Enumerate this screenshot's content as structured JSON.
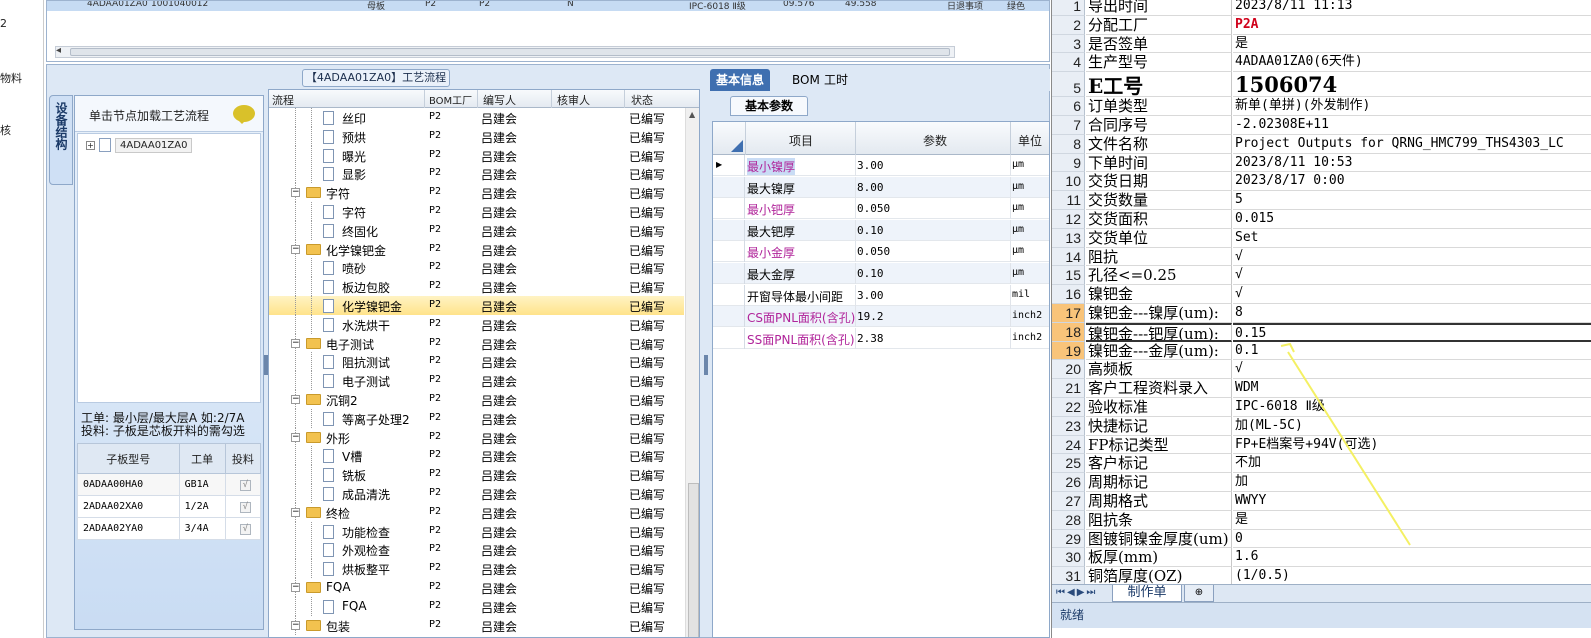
{
  "left_strip": {
    "items": [
      "2",
      "物料",
      "核"
    ]
  },
  "top_grid": {
    "row": [
      "4ADAA01ZA0",
      "1001040012",
      "母板",
      "P2",
      "P2",
      "N",
      "IPC-6018 Ⅱ级",
      "09.576",
      "49.558",
      "日退事项",
      "绿色"
    ]
  },
  "left_panel": {
    "vtab": "设备结构",
    "hint": "单击节点加载工艺流程",
    "tree_node": "4ADAA01ZA0",
    "info_line1": "工单: 最小层/最大层A 如:2/7A",
    "info_line2": "投料: 子板是芯板开料的需勾选",
    "table": {
      "headers": [
        "子板型号",
        "工单",
        "投料"
      ],
      "rows": [
        {
          "model": "0ADAA00HA0",
          "order": "GB1A",
          "check": "√"
        },
        {
          "model": "2ADAA02XA0",
          "order": "1/2A",
          "check": "√"
        },
        {
          "model": "2ADAA02YA0",
          "order": "3/4A",
          "check": "√"
        }
      ]
    }
  },
  "flow": {
    "title": "【4ADAA01ZA0】工艺流程",
    "headers": [
      "流程",
      "BOM工厂",
      "编写人",
      "核审人",
      "状态"
    ],
    "rows": [
      {
        "name": "丝印",
        "level": 2,
        "type": "doc",
        "bom": "P2",
        "editor": "吕建会",
        "status": "已编写"
      },
      {
        "name": "预烘",
        "level": 2,
        "type": "doc",
        "bom": "P2",
        "editor": "吕建会",
        "status": "已编写"
      },
      {
        "name": "曝光",
        "level": 2,
        "type": "doc",
        "bom": "P2",
        "editor": "吕建会",
        "status": "已编写"
      },
      {
        "name": "显影",
        "level": 2,
        "type": "doc",
        "bom": "P2",
        "editor": "吕建会",
        "status": "已编写"
      },
      {
        "name": "字符",
        "level": 1,
        "type": "folder",
        "bom": "P2",
        "editor": "吕建会",
        "status": "已编写"
      },
      {
        "name": "字符",
        "level": 2,
        "type": "doc",
        "bom": "P2",
        "editor": "吕建会",
        "status": "已编写"
      },
      {
        "name": "终固化",
        "level": 2,
        "type": "doc",
        "bom": "P2",
        "editor": "吕建会",
        "status": "已编写"
      },
      {
        "name": "化学镍钯金",
        "level": 1,
        "type": "folder",
        "bom": "P2",
        "editor": "吕建会",
        "status": "已编写"
      },
      {
        "name": "喷砂",
        "level": 2,
        "type": "doc",
        "bom": "P2",
        "editor": "吕建会",
        "status": "已编写"
      },
      {
        "name": "板边包胶",
        "level": 2,
        "type": "doc",
        "bom": "P2",
        "editor": "吕建会",
        "status": "已编写"
      },
      {
        "name": "化学镍钯金",
        "level": 2,
        "type": "doc",
        "bom": "P2",
        "editor": "吕建会",
        "status": "已编写",
        "selected": true
      },
      {
        "name": "水洗烘干",
        "level": 2,
        "type": "doc",
        "bom": "P2",
        "editor": "吕建会",
        "status": "已编写"
      },
      {
        "name": "电子测试",
        "level": 1,
        "type": "folder",
        "bom": "P2",
        "editor": "吕建会",
        "status": "已编写"
      },
      {
        "name": "阻抗测试",
        "level": 2,
        "type": "doc",
        "bom": "P2",
        "editor": "吕建会",
        "status": "已编写"
      },
      {
        "name": "电子测试",
        "level": 2,
        "type": "doc",
        "bom": "P2",
        "editor": "吕建会",
        "status": "已编写"
      },
      {
        "name": "沉铜2",
        "level": 1,
        "type": "folder",
        "bom": "P2",
        "editor": "吕建会",
        "status": "已编写"
      },
      {
        "name": "等离子处理2",
        "level": 2,
        "type": "doc",
        "bom": "P2",
        "editor": "吕建会",
        "status": "已编写"
      },
      {
        "name": "外形",
        "level": 1,
        "type": "folder",
        "bom": "P2",
        "editor": "吕建会",
        "status": "已编写"
      },
      {
        "name": "V槽",
        "level": 2,
        "type": "doc",
        "bom": "P2",
        "editor": "吕建会",
        "status": "已编写"
      },
      {
        "name": "铣板",
        "level": 2,
        "type": "doc",
        "bom": "P2",
        "editor": "吕建会",
        "status": "已编写"
      },
      {
        "name": "成品清洗",
        "level": 2,
        "type": "doc",
        "bom": "P2",
        "editor": "吕建会",
        "status": "已编写"
      },
      {
        "name": "终检",
        "level": 1,
        "type": "folder",
        "bom": "P2",
        "editor": "吕建会",
        "status": "已编写"
      },
      {
        "name": "功能检查",
        "level": 2,
        "type": "doc",
        "bom": "P2",
        "editor": "吕建会",
        "status": "已编写"
      },
      {
        "name": "外观检查",
        "level": 2,
        "type": "doc",
        "bom": "P2",
        "editor": "吕建会",
        "status": "已编写"
      },
      {
        "name": "烘板整平",
        "level": 2,
        "type": "doc",
        "bom": "P2",
        "editor": "吕建会",
        "status": "已编写"
      },
      {
        "name": "FQA",
        "level": 1,
        "type": "folder",
        "bom": "P2",
        "editor": "吕建会",
        "status": "已编写"
      },
      {
        "name": "FQA",
        "level": 2,
        "type": "doc",
        "bom": "P2",
        "editor": "吕建会",
        "status": "已编写"
      },
      {
        "name": "包装",
        "level": 1,
        "type": "folder",
        "bom": "P2",
        "editor": "吕建会",
        "status": "已编写"
      }
    ]
  },
  "params": {
    "tabs": [
      "基本信息",
      "BOM",
      "工时"
    ],
    "subtab": "基本参数",
    "headers": [
      "项目",
      "参数",
      "单位"
    ],
    "rows": [
      {
        "item": "最小镍厚",
        "value": "3.00",
        "unit": "μm",
        "pink": true,
        "current": true
      },
      {
        "item": "最大镍厚",
        "value": "8.00",
        "unit": "μm",
        "pink": false
      },
      {
        "item": "最小钯厚",
        "value": "0.050",
        "unit": "μm",
        "pink": true
      },
      {
        "item": "最大钯厚",
        "value": "0.10",
        "unit": "μm",
        "pink": false
      },
      {
        "item": "最小金厚",
        "value": "0.050",
        "unit": "μm",
        "pink": true
      },
      {
        "item": "最大金厚",
        "value": "0.10",
        "unit": "μm",
        "pink": false
      },
      {
        "item": "开窗导体最小间距",
        "value": "3.00",
        "unit": "mil",
        "pink": false
      },
      {
        "item": "CS面PNL面积(含孔)",
        "value": "19.2",
        "unit": "inch2",
        "pink": true
      },
      {
        "item": "SS面PNL面积(含孔)",
        "value": "2.38",
        "unit": "inch2",
        "pink": true
      }
    ]
  },
  "sheet": {
    "rows": [
      {
        "n": "1",
        "a": "导出时间",
        "b": "2023/8/11 11:13"
      },
      {
        "n": "2",
        "a": "分配工厂",
        "b": "P2A",
        "red": true
      },
      {
        "n": "3",
        "a": "是否签单",
        "b": "是"
      },
      {
        "n": "4",
        "a": "生产型号",
        "b": "4ADAA01ZA0(6天件)"
      },
      {
        "n": "5",
        "a": "E工号",
        "b": "1506074",
        "big": true
      },
      {
        "n": "6",
        "a": "订单类型",
        "b": "新单(单拼)(外发制作)"
      },
      {
        "n": "7",
        "a": "合同序号",
        "b": "-2.02308E+11"
      },
      {
        "n": "8",
        "a": "文件名称",
        "b": "Project Outputs for QRNG_HMC799_THS4303_LC"
      },
      {
        "n": "9",
        "a": "下单时间",
        "b": "2023/8/11 10:53"
      },
      {
        "n": "10",
        "a": "交货日期",
        "b": "2023/8/17 0:00"
      },
      {
        "n": "11",
        "a": "交货数量",
        "b": "5"
      },
      {
        "n": "12",
        "a": "交货面积",
        "b": "0.015"
      },
      {
        "n": "13",
        "a": "交货单位",
        "b": "Set"
      },
      {
        "n": "14",
        "a": "阻抗",
        "b": "√"
      },
      {
        "n": "15",
        "a": "孔径<=0.25",
        "b": "√"
      },
      {
        "n": "16",
        "a": "镍钯金",
        "b": "√"
      },
      {
        "n": "17",
        "a": "镍钯金---镍厚(um):",
        "b": "8",
        "hl": true
      },
      {
        "n": "18",
        "a": "镍钯金---钯厚(um):",
        "b": "0.15",
        "hl": true,
        "sel": true
      },
      {
        "n": "19",
        "a": "镍钯金---金厚(um):",
        "b": "0.1",
        "hl": true
      },
      {
        "n": "20",
        "a": "高频板",
        "b": "√"
      },
      {
        "n": "21",
        "a": "客户工程资料录入",
        "b": "WDM"
      },
      {
        "n": "22",
        "a": "验收标准",
        "b": "IPC-6018 Ⅱ级"
      },
      {
        "n": "23",
        "a": "快捷标记",
        "b": "加(ML-5C)"
      },
      {
        "n": "24",
        "a": "FP标记类型",
        "b": "FP+E档案号+94V(可选)"
      },
      {
        "n": "25",
        "a": "客户标记",
        "b": "不加"
      },
      {
        "n": "26",
        "a": "周期标记",
        "b": "加"
      },
      {
        "n": "27",
        "a": "周期格式",
        "b": "WWYY"
      },
      {
        "n": "28",
        "a": "阻抗条",
        "b": "是"
      },
      {
        "n": "29",
        "a": "图镀铜镍金厚度(um)",
        "b": "0"
      },
      {
        "n": "30",
        "a": "板厚(mm)",
        "b": "1.6"
      },
      {
        "n": "31",
        "a": "铜箔厚度(OZ)",
        "b": "(1/0.5)"
      }
    ],
    "tab": "制作单",
    "status": "就绪"
  },
  "colors": {
    "accent": "#3f6fb0",
    "highlight_row": "#ffe38a",
    "red_value": "#d0021b",
    "annotation_line": "#f4f063"
  }
}
